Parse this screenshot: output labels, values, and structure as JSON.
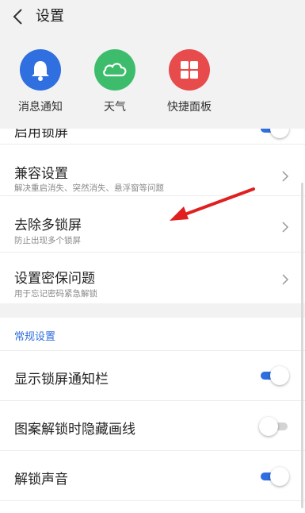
{
  "header": {
    "title": "设置"
  },
  "shortcuts": [
    {
      "label": "消息通知",
      "icon": "bell-icon",
      "color": "#2f6fe0"
    },
    {
      "label": "天气",
      "icon": "cloud-icon",
      "color": "#3dbd6b"
    },
    {
      "label": "快捷面板",
      "icon": "grid-icon",
      "color": "#e84b4b"
    }
  ],
  "list": {
    "partial_item": {
      "title": "启用锁屏"
    },
    "items": [
      {
        "title": "兼容设置",
        "subtitle": "解决重启消失、突然消失、悬浮窗等问题"
      },
      {
        "title": "去除多锁屏",
        "subtitle": "防止出现多个锁屏"
      },
      {
        "title": "设置密保问题",
        "subtitle": "用于忘记密码紧急解锁"
      }
    ]
  },
  "general": {
    "header": "常规设置",
    "toggles": [
      {
        "title": "显示锁屏通知栏",
        "state": "on"
      },
      {
        "title": "图案解锁时隐藏画线",
        "state": "off"
      },
      {
        "title": "解锁声音",
        "state": "on"
      }
    ]
  },
  "colors": {
    "accent": "#2f6fe0",
    "annotation_arrow": "#e02020"
  }
}
